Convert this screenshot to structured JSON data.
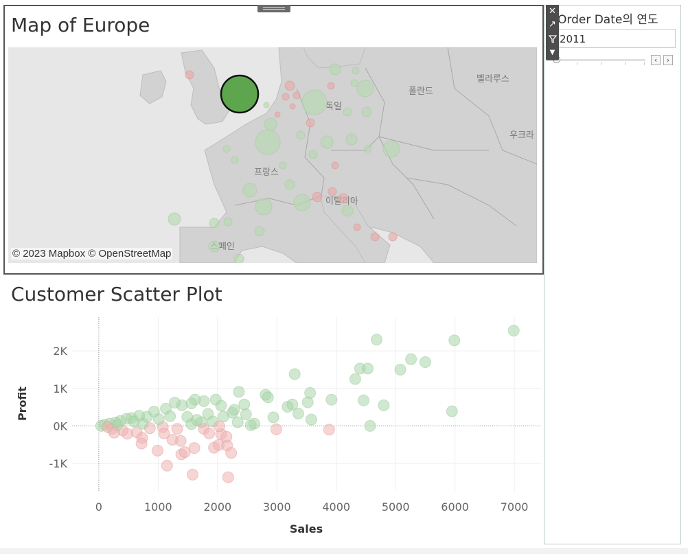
{
  "map_sheet": {
    "title": "Map of Europe",
    "credit": "© 2023 Mapbox © OpenStreetMap",
    "place_labels": [
      "폴란드",
      "벨라루스",
      "독일",
      "우크라",
      "프랑스",
      "이탈리아",
      "스페인"
    ]
  },
  "filter": {
    "title": "Order Date의 연도",
    "value": "2011",
    "prev_icon": "chevron-left-icon",
    "next_icon": "chevron-right-icon"
  },
  "toolbar": {
    "icons": [
      "close-icon",
      "pop-out-icon",
      "filter-icon",
      "more-options-icon"
    ]
  },
  "scatter": {
    "title": "Customer Scatter Plot"
  },
  "colors": {
    "positive": "#a8d5a8",
    "negative": "#efb3b3",
    "selected_marker": "#5ea64d"
  },
  "chart_data": {
    "type": "scatter",
    "title": "Customer Scatter Plot",
    "xlabel": "Sales",
    "ylabel": "Profit",
    "xlim": [
      -450,
      7450
    ],
    "ylim": [
      -1750,
      2900
    ],
    "x_ticks": [
      0,
      1000,
      2000,
      3000,
      4000,
      5000,
      6000,
      7000
    ],
    "x_tick_labels": [
      "0",
      "1000",
      "2000",
      "3000",
      "4000",
      "5000",
      "6000",
      "7000"
    ],
    "y_ticks": [
      -1000,
      0,
      1000,
      2000
    ],
    "y_tick_labels": [
      "-1K",
      "0K",
      "1K",
      "2K"
    ],
    "grid": true,
    "points": [
      [
        6990,
        2540
      ],
      [
        4680,
        2300
      ],
      [
        5990,
        2280
      ],
      [
        5260,
        1780
      ],
      [
        5500,
        1700
      ],
      [
        5080,
        1500
      ],
      [
        4400,
        1530
      ],
      [
        4530,
        1530
      ],
      [
        3300,
        1380
      ],
      [
        4320,
        1250
      ],
      [
        2360,
        910
      ],
      [
        2810,
        830
      ],
      [
        2850,
        760
      ],
      [
        3560,
        880
      ],
      [
        3920,
        700
      ],
      [
        4460,
        680
      ],
      [
        3520,
        630
      ],
      [
        3260,
        570
      ],
      [
        3180,
        510
      ],
      [
        3360,
        330
      ],
      [
        3580,
        170
      ],
      [
        2940,
        230
      ],
      [
        4800,
        550
      ],
      [
        5950,
        390
      ],
      [
        4570,
        0
      ],
      [
        3880,
        -100
      ],
      [
        2990,
        -90
      ],
      [
        2560,
        20
      ],
      [
        2450,
        570
      ],
      [
        2250,
        350
      ],
      [
        2060,
        540
      ],
      [
        1970,
        700
      ],
      [
        1770,
        660
      ],
      [
        1620,
        700
      ],
      [
        1560,
        600
      ],
      [
        1400,
        550
      ],
      [
        1280,
        620
      ],
      [
        1130,
        460
      ],
      [
        930,
        380
      ],
      [
        810,
        240
      ],
      [
        680,
        270
      ],
      [
        550,
        210
      ],
      [
        470,
        190
      ],
      [
        360,
        130
      ],
      [
        280,
        90
      ],
      [
        180,
        60
      ],
      [
        100,
        30
      ],
      [
        40,
        0
      ],
      [
        220,
        -80
      ],
      [
        400,
        -120
      ],
      [
        640,
        -170
      ],
      [
        860,
        -60
      ],
      [
        1080,
        -30
      ],
      [
        1320,
        -80
      ],
      [
        1560,
        50
      ],
      [
        1730,
        100
      ],
      [
        1920,
        120
      ],
      [
        2100,
        250
      ],
      [
        2280,
        430
      ],
      [
        2480,
        310
      ],
      [
        1840,
        320
      ],
      [
        1650,
        160
      ],
      [
        1490,
        240
      ],
      [
        1200,
        260
      ],
      [
        1010,
        180
      ],
      [
        740,
        60
      ],
      [
        590,
        120
      ],
      [
        310,
        20
      ],
      [
        150,
        -30
      ],
      [
        260,
        -180
      ],
      [
        480,
        -210
      ],
      [
        730,
        -320
      ],
      [
        720,
        -470
      ],
      [
        990,
        -660
      ],
      [
        1150,
        -1060
      ],
      [
        1390,
        -760
      ],
      [
        1450,
        -700
      ],
      [
        1610,
        -590
      ],
      [
        1580,
        -1300
      ],
      [
        1940,
        -580
      ],
      [
        2020,
        -510
      ],
      [
        2160,
        -520
      ],
      [
        2230,
        -720
      ],
      [
        2180,
        -1370
      ],
      [
        1380,
        -400
      ],
      [
        1100,
        -200
      ],
      [
        1240,
        -370
      ],
      [
        2060,
        -220
      ],
      [
        2150,
        -290
      ],
      [
        1770,
        -80
      ],
      [
        1860,
        -200
      ],
      [
        2030,
        -10
      ],
      [
        2340,
        100
      ],
      [
        2620,
        60
      ]
    ]
  }
}
